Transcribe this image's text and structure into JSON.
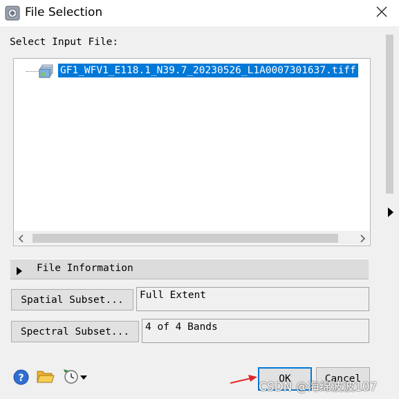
{
  "window": {
    "title": "File Selection"
  },
  "select_input": {
    "label": "Select Input File:",
    "files": [
      "GF1_WFV1_E118.1_N39.7_20230526_L1A0007301637.tiff"
    ]
  },
  "file_information": {
    "label": "File Information"
  },
  "spatial_subset": {
    "button_label": "Spatial Subset...",
    "value": "Full Extent"
  },
  "spectral_subset": {
    "button_label": "Spectral Subset...",
    "value": "4 of 4 Bands"
  },
  "buttons": {
    "ok_label": "OK",
    "cancel_label": "Cancel"
  },
  "watermark": "CSDN @海绵波波107",
  "icons": [
    "help-icon",
    "open-folder-icon",
    "options-icon"
  ],
  "colors": {
    "selection": "#0078d7",
    "help_icon": "#2f6fd0",
    "arrow": "#e0282a"
  }
}
